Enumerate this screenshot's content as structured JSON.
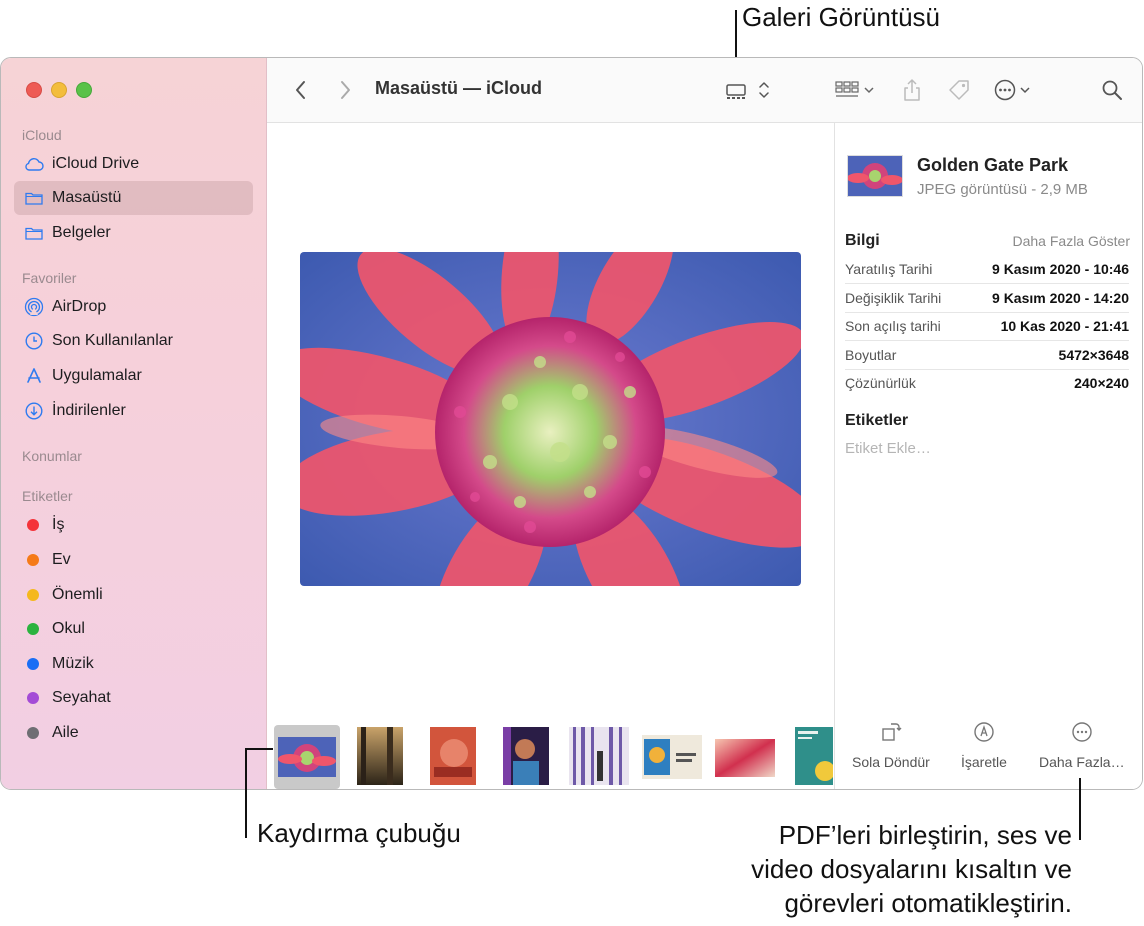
{
  "callouts": {
    "gallery_view": "Galeri Görüntüsü",
    "scrubber": "Kaydırma çubuğu",
    "more_line1": "PDF’leri birleştirin, ses ve",
    "more_line2": "video dosyalarını kısaltın ve",
    "more_line3": "görevleri otomatikleştirin."
  },
  "sidebar": {
    "sections": {
      "icloud": "iCloud",
      "favorites": "Favoriler",
      "locations": "Konumlar",
      "tags": "Etiketler"
    },
    "icloud_items": [
      {
        "label": "iCloud Drive",
        "icon": "cloud-icon"
      },
      {
        "label": "Masaüstü",
        "icon": "folder-icon",
        "selected": true
      },
      {
        "label": "Belgeler",
        "icon": "folder-icon"
      }
    ],
    "favorite_items": [
      {
        "label": "AirDrop",
        "icon": "airdrop-icon"
      },
      {
        "label": "Son Kullanılanlar",
        "icon": "clock-icon"
      },
      {
        "label": "Uygulamalar",
        "icon": "applications-icon"
      },
      {
        "label": "İndirilenler",
        "icon": "download-icon"
      }
    ],
    "tag_items": [
      {
        "label": "İş",
        "color": "#f4333a"
      },
      {
        "label": "Ev",
        "color": "#f57a18"
      },
      {
        "label": "Önemli",
        "color": "#f5b81d"
      },
      {
        "label": "Okul",
        "color": "#2bb33f"
      },
      {
        "label": "Müzik",
        "color": "#1a6ef5"
      },
      {
        "label": "Seyahat",
        "color": "#a44bd6"
      },
      {
        "label": "Aile",
        "color": "#6e6e73"
      }
    ]
  },
  "toolbar": {
    "title": "Masaüstü — iCloud"
  },
  "inspector": {
    "file_name": "Golden Gate Park",
    "file_kind": "JPEG görüntüsü - 2,9 MB",
    "info_heading": "Bilgi",
    "show_more": "Daha Fazla Göster",
    "rows": [
      {
        "key": "Yaratılış Tarihi",
        "value": "9 Kasım 2020 - 10:46"
      },
      {
        "key": "Değişiklik Tarihi",
        "value": "9 Kasım 2020 - 14:20"
      },
      {
        "key": "Son açılış tarihi",
        "value": "10 Kas 2020 - 21:41"
      },
      {
        "key": "Boyutlar",
        "value": "5472×3648"
      },
      {
        "key": "Çözünürlük",
        "value": "240×240"
      }
    ],
    "tags_heading": "Etiketler",
    "tags_placeholder": "Etiket Ekle…",
    "actions": {
      "rotate": "Sola Döndür",
      "markup": "İşaretle",
      "more": "Daha Fazla…"
    }
  }
}
